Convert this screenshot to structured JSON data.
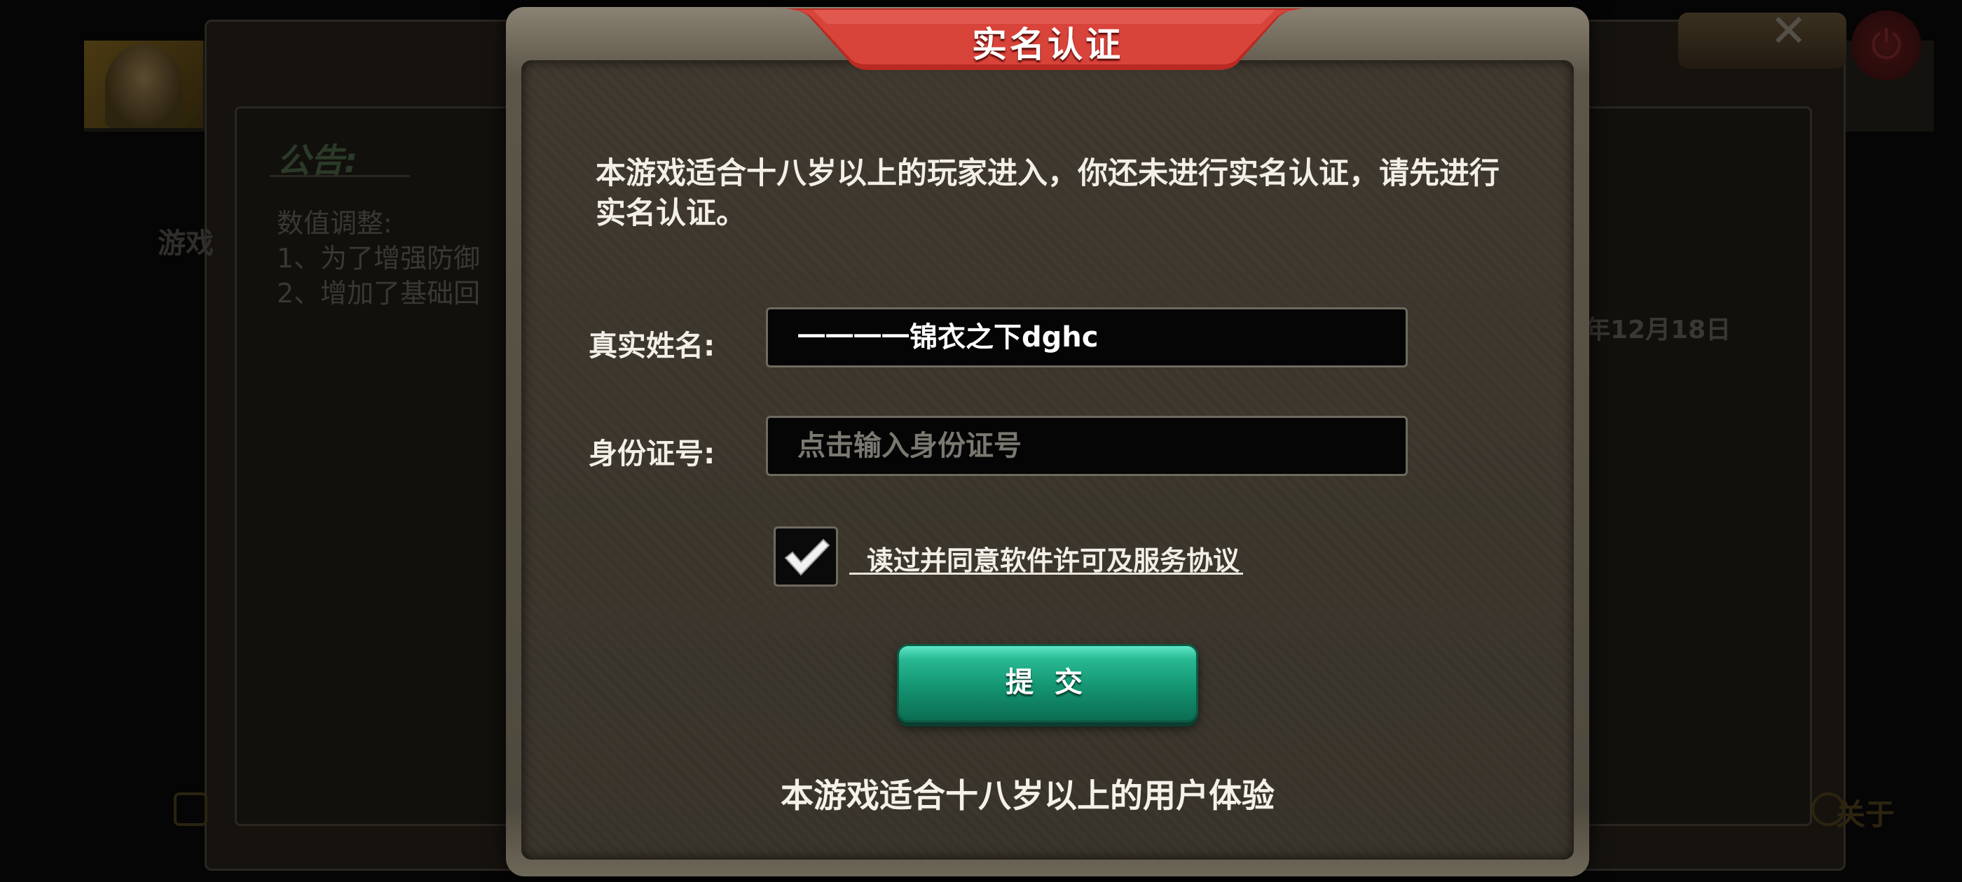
{
  "background": {
    "notice_heading": "公告:",
    "notice_line1": "数值调整:",
    "notice_line2": "1、为了增强防御",
    "notice_line3": "2、增加了基础回",
    "side_tab": "游戏",
    "date": "年12月18日",
    "about": "关于"
  },
  "dialog": {
    "title": "实名认证",
    "intro": "本游戏适合十八岁以上的玩家进入，你还未进行实名认证，请先进行实名认证。",
    "name_label": "真实姓名:",
    "name_value": "一一一一锦衣之下dghc",
    "id_label": "身份证号:",
    "id_placeholder": "点击输入身份证号",
    "agreement_checked": true,
    "agreement_text": "读过并同意软件许可及服务协议",
    "submit_label": "提交",
    "footer_note": "本游戏适合十八岁以上的用户体验"
  },
  "colors": {
    "title_banner": "#c8352c",
    "submit_button": "#13906e",
    "modal_body": "#3e382e"
  }
}
